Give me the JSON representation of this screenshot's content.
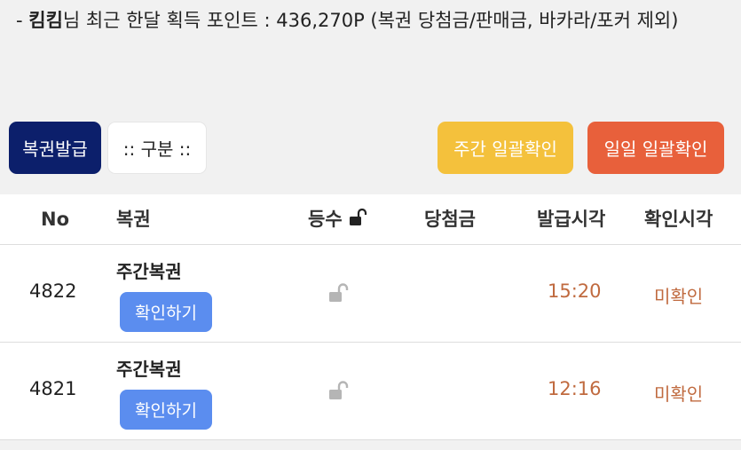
{
  "notice": {
    "prefix": "- ",
    "user": "킴킴",
    "text": "님 최근 한달 획득 포인트 : 436,270P (복권 당첨금/판매금, 바카라/포커 제외)"
  },
  "toolbar": {
    "issue_label": "복권발급",
    "filter_label": ":: 구분 ::",
    "weekly_label": "주간 일괄확인",
    "daily_label": "일일 일괄확인"
  },
  "table": {
    "headers": {
      "no": "No",
      "lottery": "복권",
      "rank": "등수",
      "prize": "당첨금",
      "issued": "발급시각",
      "checked": "확인시각"
    },
    "rows": [
      {
        "no": "4822",
        "type": "주간복권",
        "button": "확인하기",
        "time": "15:20",
        "status": "미확인"
      },
      {
        "no": "4821",
        "type": "주간복권",
        "button": "확인하기",
        "time": "12:16",
        "status": "미확인"
      }
    ]
  },
  "colors": {
    "issue_button": "#0c1f6b",
    "weekly_button": "#f4c13c",
    "daily_button": "#e8603b",
    "confirm_button": "#5b8def",
    "time_text": "#c06a3f"
  },
  "icons": {
    "rank_header": "unlock-icon",
    "row_lock": "unlock-icon"
  }
}
